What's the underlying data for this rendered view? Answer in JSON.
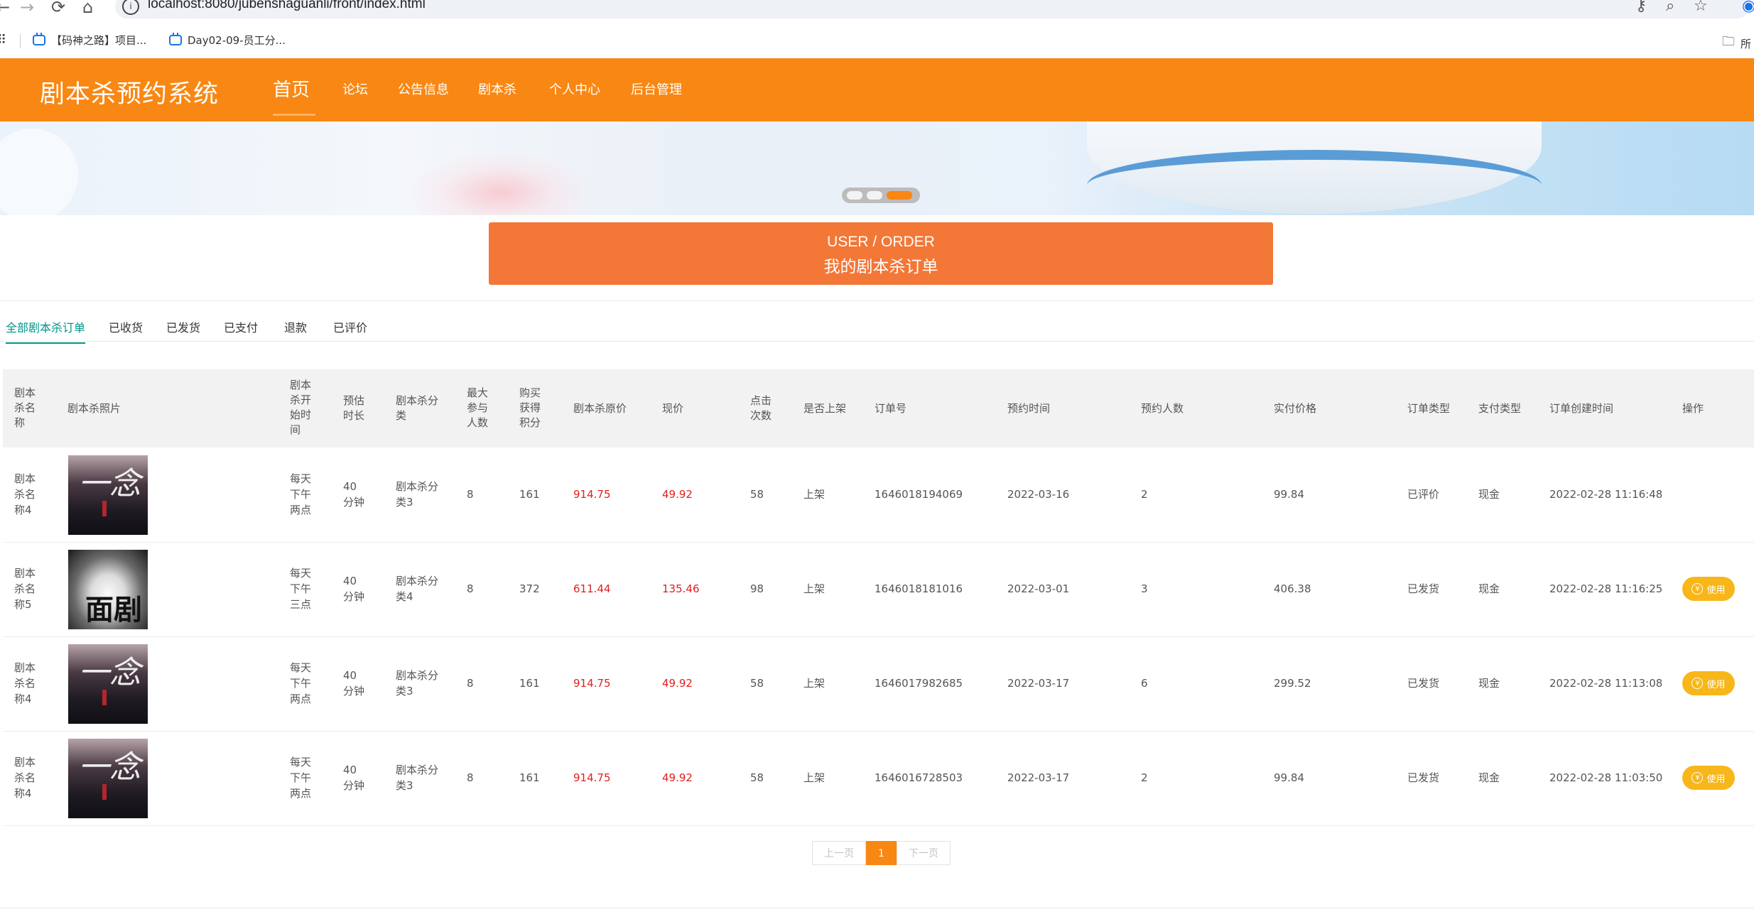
{
  "browser": {
    "url": "localhost:8080/jubenshaguanli/front/index.html",
    "bookmarks": [
      "【码神之路】项目...",
      "Day02-09-员工分..."
    ],
    "bookmarks_folder": "所"
  },
  "header": {
    "brand": "剧本杀预约系统",
    "nav": [
      "首页",
      "论坛",
      "公告信息",
      "剧本杀",
      "个人中心",
      "后台管理"
    ],
    "active_nav": "首页"
  },
  "banner": {
    "slides": 3,
    "active_slide": 3
  },
  "order_bar": {
    "title_en": "USER / ORDER",
    "title_cn": "我的剧本杀订单"
  },
  "tabs": [
    "全部剧本杀订单",
    "已收货",
    "已发货",
    "已支付",
    "退款",
    "已评价"
  ],
  "active_tab": "全部剧本杀订单",
  "table": {
    "headers": [
      "剧本杀名称",
      "剧本杀照片",
      "剧本杀开始时间",
      "预估时长",
      "剧本杀分类",
      "最大参与人数",
      "购买获得积分",
      "剧本杀原价",
      "现价",
      "点击次数",
      "是否上架",
      "订单号",
      "预约时间",
      "预约人数",
      "实付价格",
      "订单类型",
      "支付类型",
      "订单创建时间",
      "操作"
    ],
    "rows": [
      {
        "name": "剧本杀名称4",
        "poster": "poster-a",
        "start": "每天下午两点",
        "duration": "40分钟",
        "category": "剧本杀分类3",
        "max_people": "8",
        "points": "161",
        "orig_price": "914.75",
        "price": "49.92",
        "clicks": "58",
        "on_shelf": "上架",
        "order_no": "1646018194069",
        "reserve_time": "2022-03-16",
        "people": "2",
        "paid": "99.84",
        "order_type": "已评价",
        "pay_type": "现金",
        "created": "2022-02-28 11:16:48",
        "action": ""
      },
      {
        "name": "剧本杀名称5",
        "poster": "poster-b",
        "start": "每天下午三点",
        "duration": "40分钟",
        "category": "剧本杀分类4",
        "max_people": "8",
        "points": "372",
        "orig_price": "611.44",
        "price": "135.46",
        "clicks": "98",
        "on_shelf": "上架",
        "order_no": "1646018181016",
        "reserve_time": "2022-03-01",
        "people": "3",
        "paid": "406.38",
        "order_type": "已发货",
        "pay_type": "现金",
        "created": "2022-02-28 11:16:25",
        "action": "使用"
      },
      {
        "name": "剧本杀名称4",
        "poster": "poster-a",
        "start": "每天下午两点",
        "duration": "40分钟",
        "category": "剧本杀分类3",
        "max_people": "8",
        "points": "161",
        "orig_price": "914.75",
        "price": "49.92",
        "clicks": "58",
        "on_shelf": "上架",
        "order_no": "1646017982685",
        "reserve_time": "2022-03-17",
        "people": "6",
        "paid": "299.52",
        "order_type": "已发货",
        "pay_type": "现金",
        "created": "2022-02-28 11:13:08",
        "action": "使用"
      },
      {
        "name": "剧本杀名称4",
        "poster": "poster-a",
        "start": "每天下午两点",
        "duration": "40分钟",
        "category": "剧本杀分类3",
        "max_people": "8",
        "points": "161",
        "orig_price": "914.75",
        "price": "49.92",
        "clicks": "58",
        "on_shelf": "上架",
        "order_no": "1646016728503",
        "reserve_time": "2022-03-17",
        "people": "2",
        "paid": "99.84",
        "order_type": "已发货",
        "pay_type": "现金",
        "created": "2022-02-28 11:03:50",
        "action": "使用"
      }
    ]
  },
  "pagination": {
    "prev": "上一页",
    "current": "1",
    "next": "下一页"
  },
  "colors": {
    "brand_orange": "#f98713",
    "order_bar": "#f37737",
    "tab_active": "#009688",
    "price_red": "#e02020",
    "use_button": "#f7b71a"
  }
}
